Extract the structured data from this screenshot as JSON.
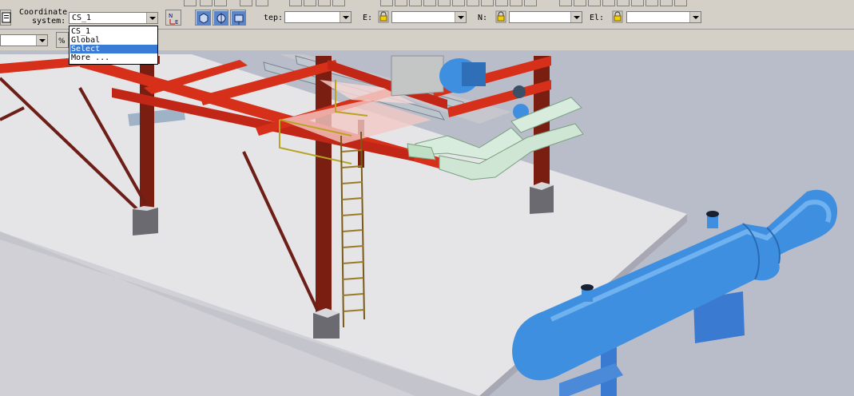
{
  "toolbar": {
    "coord_label_line1": "Coordinate",
    "coord_label_line2": "system:",
    "coord_value": "CS_1",
    "step_label": "tep:",
    "e_label": "E:",
    "n_label": "N:",
    "el_label": "El:"
  },
  "dropdown": {
    "items": [
      "CS_1",
      "Global",
      "Select Graphically",
      "More ..."
    ],
    "selected_index": 2
  },
  "colors": {
    "background": "#b9bdca",
    "platform": "#e4e4e6",
    "steel_red": "#d6301a",
    "column_dark": "#7a1e12",
    "vessel_blue": "#3e8fe0",
    "cable_tray": "#d8ecdd",
    "selection": "#3a7bd5"
  }
}
